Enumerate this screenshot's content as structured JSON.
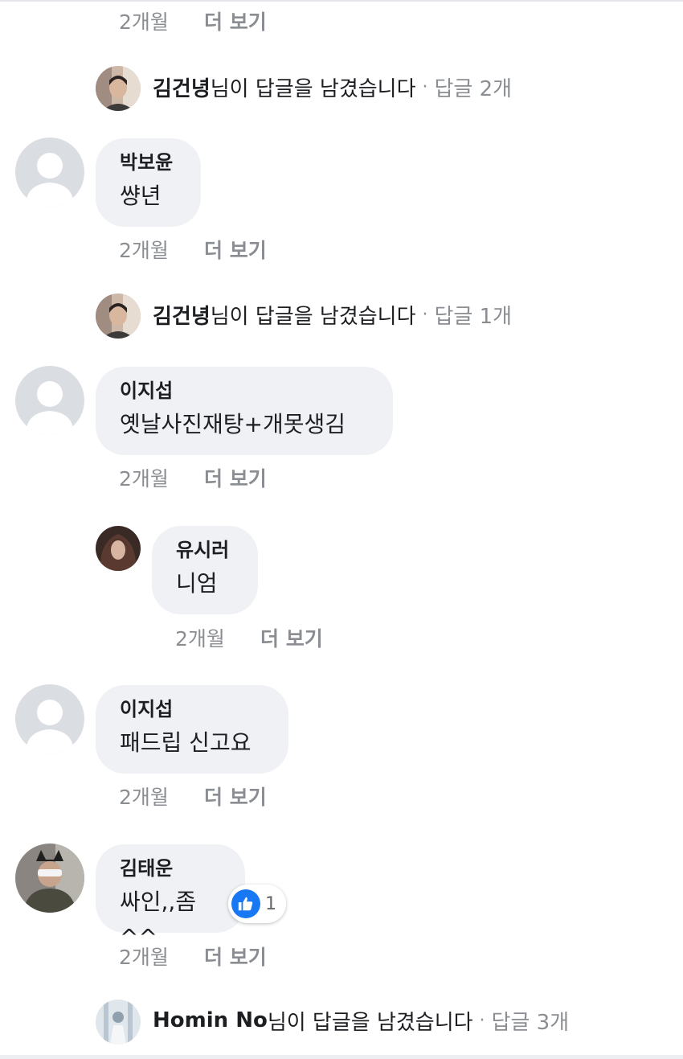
{
  "top_meta": {
    "time": "2개월",
    "more": "더 보기"
  },
  "reply_summaries": [
    {
      "name": "김건녕",
      "suffix": "님이 답글을 남겼습니다",
      "sep": "·",
      "count": "답글 2개"
    },
    {
      "name": "김건녕",
      "suffix": "님이 답글을 남겼습니다",
      "sep": "·",
      "count": "답글 1개"
    },
    {
      "name": "Homin No",
      "suffix": "님이 답글을 남겼습니다",
      "sep": "·",
      "count": "답글 3개"
    }
  ],
  "comments": [
    {
      "author": "박보윤",
      "text": "썅년",
      "time": "2개월",
      "more": "더 보기"
    },
    {
      "author": "이지섭",
      "text": "옛날사진재탕+개못생김",
      "time": "2개월",
      "more": "더 보기"
    },
    {
      "author": "유시러",
      "text": "니엄",
      "time": "2개월",
      "more": "더 보기"
    },
    {
      "author": "이지섭",
      "text": "패드립 신고요",
      "time": "2개월",
      "more": "더 보기"
    },
    {
      "author": "김태운",
      "text": "싸인,,좀^^",
      "time": "2개월",
      "more": "더 보기",
      "reaction_icon": "like-icon",
      "reaction_count": "1"
    }
  ],
  "colors": {
    "like": "#1877f2",
    "bubble": "#eff1f4",
    "muted": "#8a8d91"
  }
}
